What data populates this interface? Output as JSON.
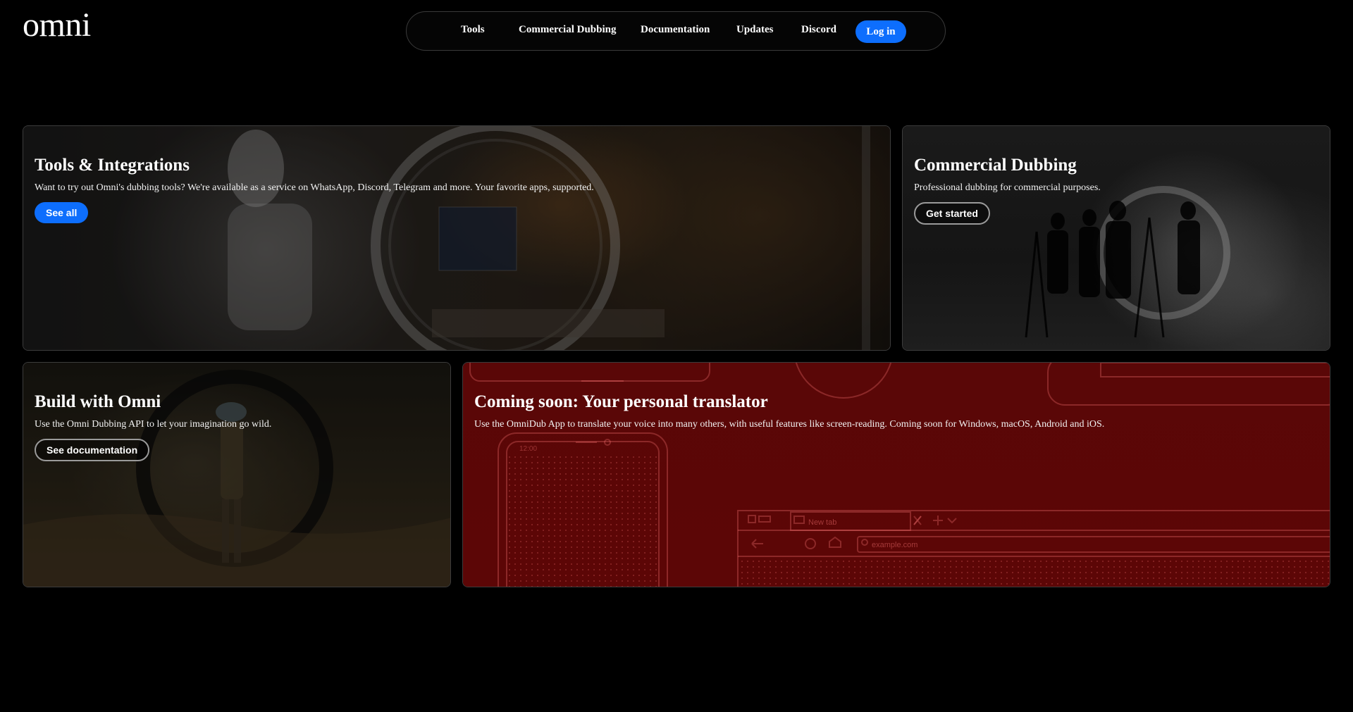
{
  "brand": {
    "logo_text": "omni"
  },
  "nav": {
    "items": [
      {
        "label": "Tools"
      },
      {
        "label": "Commercial Dubbing"
      },
      {
        "label": "Documentation"
      },
      {
        "label": "Updates"
      },
      {
        "label": "Discord"
      }
    ],
    "login_label": "Log in",
    "accent_color": "#0d6efd"
  },
  "cards": {
    "tools": {
      "title": "Tools & Integrations",
      "description": "Want to try out Omni's dubbing tools? We're available as a service on WhatsApp, Discord, Telegram and more. Your favorite apps, supported.",
      "button_label": "See all"
    },
    "commercial": {
      "title": "Commercial Dubbing",
      "description": "Professional dubbing for commercial purposes.",
      "button_label": "Get started"
    },
    "build": {
      "title": "Build with Omni",
      "description": "Use the Omni Dubbing API to let your imagination go wild.",
      "button_label": "See documentation"
    },
    "soon": {
      "title": "Coming soon: Your personal translator",
      "description": "Use the OmniDub App to translate your voice into many others, with useful features like screen-reading. Coming soon for Windows, macOS, Android and iOS.",
      "phone_time": "12:00",
      "browser_tab_label": "New tab",
      "browser_url": "example.com",
      "card_color": "#5a0707"
    }
  }
}
